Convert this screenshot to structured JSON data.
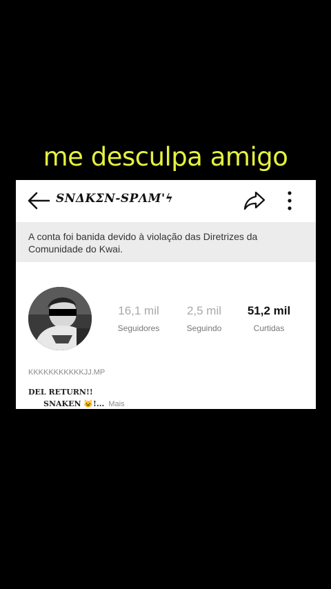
{
  "caption": "me desculpa amigo",
  "header": {
    "username": "SNΔKΣN-SPΛM'ϟ"
  },
  "banner": {
    "text": "A conta foi banida devido à violação das Diretrizes da Comunidade do Kwai."
  },
  "stats": [
    {
      "value": "16,1 mil",
      "label": "Seguidores"
    },
    {
      "value": "2,5 mil",
      "label": "Seguindo"
    },
    {
      "value": "51,2 mil",
      "label": "Curtidas"
    }
  ],
  "bio": {
    "handle": "KKKKKKKKKKKJJ.MP",
    "line1": "DEL RETURN!!",
    "line2": "SNAKEN 😺!...",
    "more": "Mais"
  },
  "icons": {
    "back": "arrow-left-icon",
    "share": "share-arrow-icon",
    "more": "more-vertical-icon"
  },
  "colors": {
    "caption": "#e6f23d",
    "banner_bg": "#ececec",
    "background": "#000000"
  }
}
